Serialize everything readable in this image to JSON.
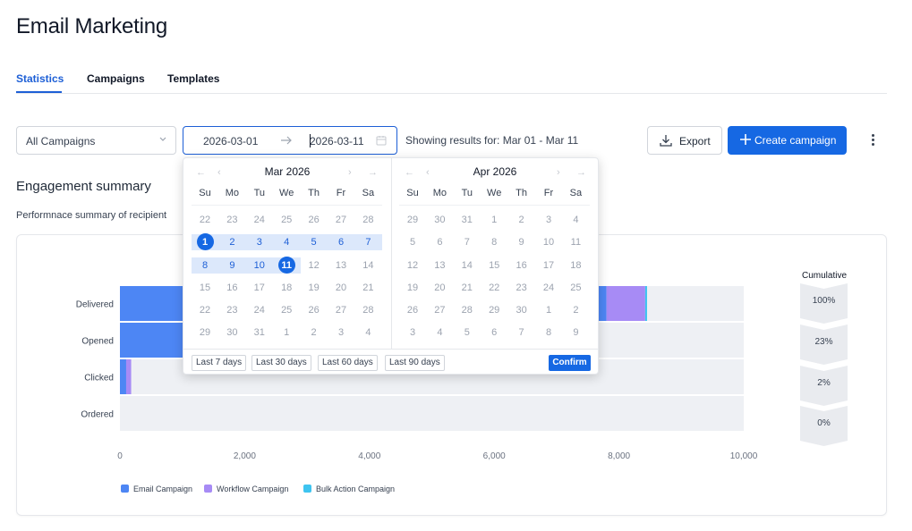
{
  "page_title": "Email Marketing",
  "tabs": [
    {
      "label": "Statistics",
      "active": true
    },
    {
      "label": "Campaigns",
      "active": false
    },
    {
      "label": "Templates",
      "active": false
    }
  ],
  "filters": {
    "campaign_select": "All Campaigns",
    "date_from": "2026-03-01",
    "date_to": "2026-03-11",
    "showing_text": "Showing results for: Mar 01 - Mar 11"
  },
  "actions": {
    "export_label": "Export",
    "create_label": "Create campaign"
  },
  "section": {
    "title": "Engagement summary",
    "subtitle": "Performnace summary of recipient"
  },
  "chart_data": {
    "type": "bar",
    "orientation": "horizontal",
    "stacked": true,
    "categories": [
      "Delivered",
      "Opened",
      "Clicked",
      "Ordered"
    ],
    "series": [
      {
        "name": "Email Campaign",
        "color": "#4d86f4",
        "values": [
          7800,
          4000,
          100,
          0
        ]
      },
      {
        "name": "Workflow Campaign",
        "color": "#a78bf5",
        "values": [
          620,
          0,
          80,
          0
        ]
      },
      {
        "name": "Bulk Action Campaign",
        "color": "#3ec4f0",
        "values": [
          30,
          0,
          0,
          0
        ]
      }
    ],
    "xlim": [
      0,
      10000
    ],
    "xticks": [
      "0",
      "2,000",
      "4,000",
      "6,000",
      "8,000",
      "10,000"
    ],
    "legend_position": "bottom-left",
    "cumulative_title": "Cumulative",
    "cumulative": [
      "100%",
      "23%",
      "2%",
      "0%"
    ]
  },
  "datepicker": {
    "weekdays": [
      "Su",
      "Mo",
      "Tu",
      "We",
      "Th",
      "Fr",
      "Sa"
    ],
    "months": [
      {
        "title": "Mar 2026",
        "weeks": [
          [
            "22",
            "23",
            "24",
            "25",
            "26",
            "27",
            "28"
          ],
          [
            "1",
            "2",
            "3",
            "4",
            "5",
            "6",
            "7"
          ],
          [
            "8",
            "9",
            "10",
            "11",
            "12",
            "13",
            "14"
          ],
          [
            "15",
            "16",
            "17",
            "18",
            "19",
            "20",
            "21"
          ],
          [
            "22",
            "23",
            "24",
            "25",
            "26",
            "27",
            "28"
          ],
          [
            "29",
            "30",
            "31",
            "1",
            "2",
            "3",
            "4"
          ]
        ],
        "range_cells": [
          [
            1,
            0
          ],
          [
            1,
            1
          ],
          [
            1,
            2
          ],
          [
            1,
            3
          ],
          [
            1,
            4
          ],
          [
            1,
            5
          ],
          [
            1,
            6
          ],
          [
            2,
            0
          ],
          [
            2,
            1
          ],
          [
            2,
            2
          ],
          [
            2,
            3
          ]
        ],
        "selected_cells": [
          [
            1,
            0
          ],
          [
            2,
            3
          ]
        ]
      },
      {
        "title": "Apr 2026",
        "weeks": [
          [
            "29",
            "30",
            "31",
            "1",
            "2",
            "3",
            "4"
          ],
          [
            "5",
            "6",
            "7",
            "8",
            "9",
            "10",
            "11"
          ],
          [
            "12",
            "13",
            "14",
            "15",
            "16",
            "17",
            "18"
          ],
          [
            "19",
            "20",
            "21",
            "22",
            "23",
            "24",
            "25"
          ],
          [
            "26",
            "27",
            "28",
            "29",
            "30",
            "1",
            "2"
          ],
          [
            "3",
            "4",
            "5",
            "6",
            "7",
            "8",
            "9"
          ]
        ],
        "range_cells": [],
        "selected_cells": []
      }
    ],
    "presets": [
      "Last 7 days",
      "Last 30 days",
      "Last 60 days",
      "Last 90 days"
    ],
    "confirm_label": "Confirm"
  }
}
